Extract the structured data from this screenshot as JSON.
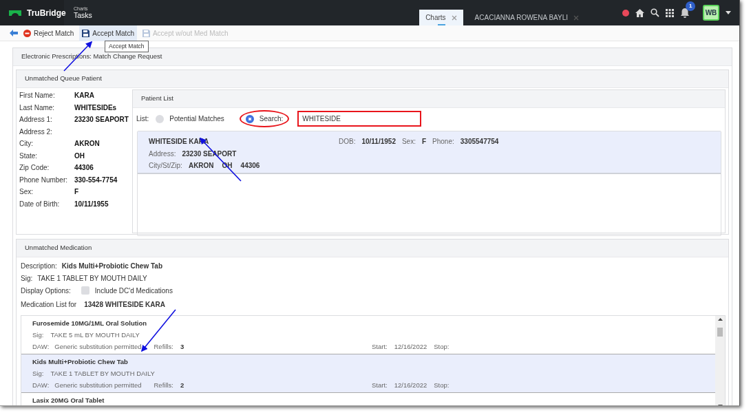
{
  "topbar": {
    "logo": "TruBridge",
    "breadcrumb_parent": "Charts",
    "breadcrumb_current": "Tasks",
    "tabs": [
      {
        "label": "Charts",
        "selected": true
      },
      {
        "label": "ACACIANNA ROWENA BAYLI",
        "selected": false
      }
    ],
    "notification_count": "1",
    "avatar": "WB"
  },
  "toolbar": {
    "buttons": [
      {
        "kind": "reject",
        "label": "Reject Match",
        "disabled": false,
        "hovered": false
      },
      {
        "kind": "save",
        "label": "Accept Match",
        "disabled": false,
        "hovered": true
      },
      {
        "kind": "save",
        "label": "Accept w/out Med Match",
        "disabled": true,
        "hovered": false
      }
    ],
    "tooltip": "Accept Match"
  },
  "page_title": "Electronic Prescriptions: Match Change Request",
  "patient_section": {
    "title": "Unmatched Queue Patient",
    "fields": [
      {
        "label": "First Name:",
        "value": "KARA"
      },
      {
        "label": "Last Name:",
        "value": "WHITESIDEs"
      },
      {
        "label": "Address 1:",
        "value": "23230 SEAPORT"
      },
      {
        "label": "Address 2:"
      },
      {
        "label": "City:",
        "value": "AKRON"
      },
      {
        "label": "State:",
        "value": "OH"
      },
      {
        "label": "Zip Code:",
        "value": "44306"
      },
      {
        "label": "Phone Number:",
        "value": "330-554-7754"
      },
      {
        "label": "Sex:",
        "value": "F"
      },
      {
        "label": "Date of Birth:",
        "value": "10/11/1955"
      }
    ]
  },
  "patient_list": {
    "title": "Patient List",
    "list_label": "List:",
    "options": [
      {
        "label": "Potential Matches",
        "selected": false
      },
      {
        "label": "Search:",
        "selected": true
      }
    ],
    "search_value": "WHITESIDE",
    "results": [
      {
        "name": "WHITESIDE KARA",
        "dob_label": "DOB:",
        "dob": "10/11/1952",
        "sex_label": "Sex:",
        "sex": "F",
        "phone_label": "Phone:",
        "phone": "3305547754",
        "address_label": "Address:",
        "address": "23230 SEAPORT",
        "city_label": "City/St/Zip:",
        "city": "AKRON",
        "state": "OH",
        "zip": "44306",
        "selected": true
      }
    ]
  },
  "medication_section": {
    "title": "Unmatched Medication",
    "description_label": "Description:",
    "description": "Kids Multi+Probiotic Chew Tab",
    "sig_label": "Sig:",
    "sig": "TAKE 1 TABLET BY MOUTH DAILY",
    "display_label": "Display Options:",
    "include_dc": {
      "label": "Include DC'd Medications",
      "checked": false
    },
    "list_label": "Medication List for",
    "list_patient": "13428 WHITESIDE KARA",
    "medications": [
      {
        "name": "Furosemide 10MG/1ML Oral Solution",
        "sig_label": "Sig:",
        "sig": "TAKE 5 mL BY MOUTH DAILY",
        "daw_label": "DAW:",
        "daw": "Generic substitution permitted",
        "refills_label": "Refills:",
        "refills": "3",
        "start_label": "Start:",
        "start": "12/16/2022",
        "stop_label": "Stop:",
        "selected": false
      },
      {
        "name": "Kids Multi+Probiotic Chew Tab",
        "sig_label": "Sig:",
        "sig": "TAKE 1 TABLET BY MOUTH DAILY",
        "daw_label": "DAW:",
        "daw": "Generic substitution permitted",
        "refills_label": "Refills:",
        "refills": "2",
        "start_label": "Start:",
        "start": "12/16/2022",
        "stop_label": "Stop:",
        "selected": true
      },
      {
        "name": "Lasix 20MG Oral Tablet",
        "selected": false
      }
    ]
  }
}
